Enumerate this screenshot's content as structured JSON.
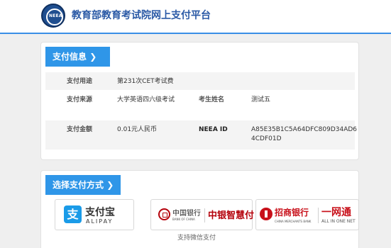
{
  "header": {
    "logo_text": "NEEA",
    "title": "教育部教育考试院网上支付平台"
  },
  "payment_info": {
    "section_label": "支付信息",
    "arrow": "❯",
    "purpose_label": "支付用途",
    "purpose_value": "第231次CET考试费",
    "source_label": "支付来源",
    "source_value": "大学英语四六级考试",
    "examinee_label": "考生姓名",
    "examinee_value": "测试五",
    "amount_label": "支付金额",
    "amount_value": "0.01元人民币",
    "neea_id_label": "NEEA ID",
    "neea_id_value": "A85E35B1C5A64DFC809D34AD64CDF01D"
  },
  "payment_method": {
    "section_label": "选择支付方式",
    "arrow": "❯",
    "alipay": {
      "badge": "支",
      "name": "支付宝",
      "en": "ALIPAY"
    },
    "boc": {
      "cn": "中国银行",
      "en": "BANK OF CHINA",
      "brand": "中银智慧付"
    },
    "cmb": {
      "cn": "招商银行",
      "en": "CHINA MERCHANTS BANK",
      "brand": "一网通",
      "brand_en": "ALL IN ONE NET"
    },
    "wechat_note": "支持微信支付"
  },
  "colors": {
    "accent": "#2f96e8",
    "title_blue": "#2b5aa6",
    "bank_red": "#c8101a"
  }
}
